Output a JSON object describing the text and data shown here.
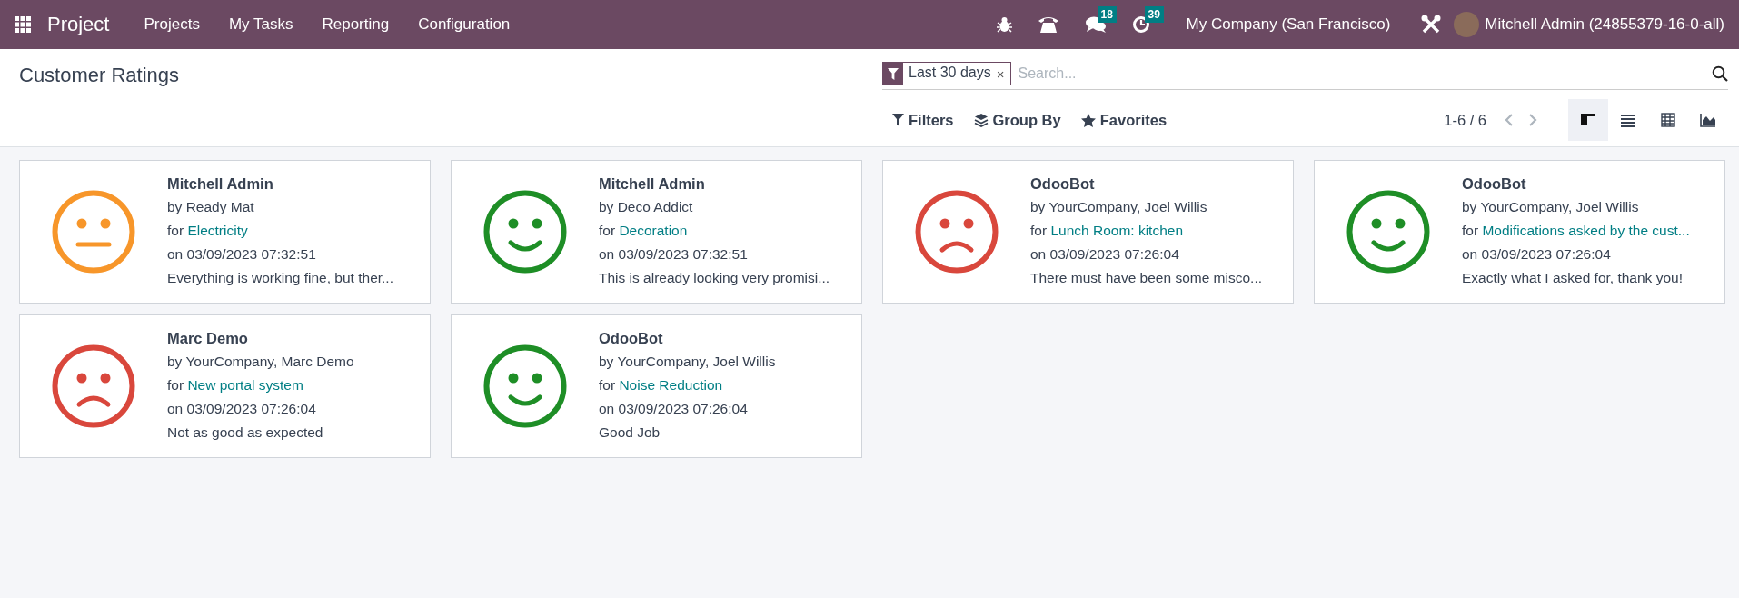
{
  "navbar": {
    "app_name": "Project",
    "menu": [
      "Projects",
      "My Tasks",
      "Reporting",
      "Configuration"
    ],
    "messages_badge": "18",
    "activities_badge": "39",
    "company": "My Company (San Francisco)",
    "user": "Mitchell Admin (24855379-16-0-all)"
  },
  "control_panel": {
    "title": "Customer Ratings",
    "facets": [
      {
        "label": "Last 30 days",
        "remove": "×"
      }
    ],
    "search": {
      "placeholder": "Search..."
    },
    "buttons": [
      {
        "kind": "filter",
        "label": "Filters"
      },
      {
        "kind": "group",
        "label": "Group By"
      },
      {
        "kind": "favorite",
        "label": "Favorites"
      }
    ],
    "pager": "1-6 / 6",
    "views": [
      {
        "kind": "kanban",
        "selected": true
      },
      {
        "kind": "list",
        "selected": false
      },
      {
        "kind": "pivot",
        "selected": false
      },
      {
        "kind": "graph",
        "selected": false
      }
    ]
  },
  "ratings": [
    {
      "kind": "okay",
      "author": "Mitchell Admin",
      "by": "by Ready Mat",
      "for": "for",
      "task": "Electricity",
      "date": "on 03/09/2023 07:32:51",
      "comment": "Everything is working fine, but ther..."
    },
    {
      "kind": "satisfied",
      "author": "Mitchell Admin",
      "by": "by Deco Addict",
      "for": "for",
      "task": "Decoration",
      "date": "on 03/09/2023 07:32:51",
      "comment": "This is already looking very promisi..."
    },
    {
      "kind": "dissatisfied",
      "author": "OdooBot",
      "by": "by YourCompany, Joel Willis",
      "for": "for",
      "task": "Lunch Room: kitchen",
      "date": "on 03/09/2023 07:26:04",
      "comment": "There must have been some misco..."
    },
    {
      "kind": "satisfied",
      "author": "OdooBot",
      "by": "by YourCompany, Joel Willis",
      "for": "for",
      "task": "Modifications asked by the cust...",
      "date": "on 03/09/2023 07:26:04",
      "comment": "Exactly what I asked for, thank you!"
    },
    {
      "kind": "dissatisfied",
      "author": "Marc Demo",
      "by": "by YourCompany, Marc Demo",
      "for": "for",
      "task": "New portal system",
      "date": "on 03/09/2023 07:26:04",
      "comment": "Not as good as expected"
    },
    {
      "kind": "satisfied",
      "author": "OdooBot",
      "by": "by YourCompany, Joel Willis",
      "for": "for",
      "task": "Noise Reduction",
      "date": "on 03/09/2023 07:26:04",
      "comment": "Good Job"
    }
  ]
}
